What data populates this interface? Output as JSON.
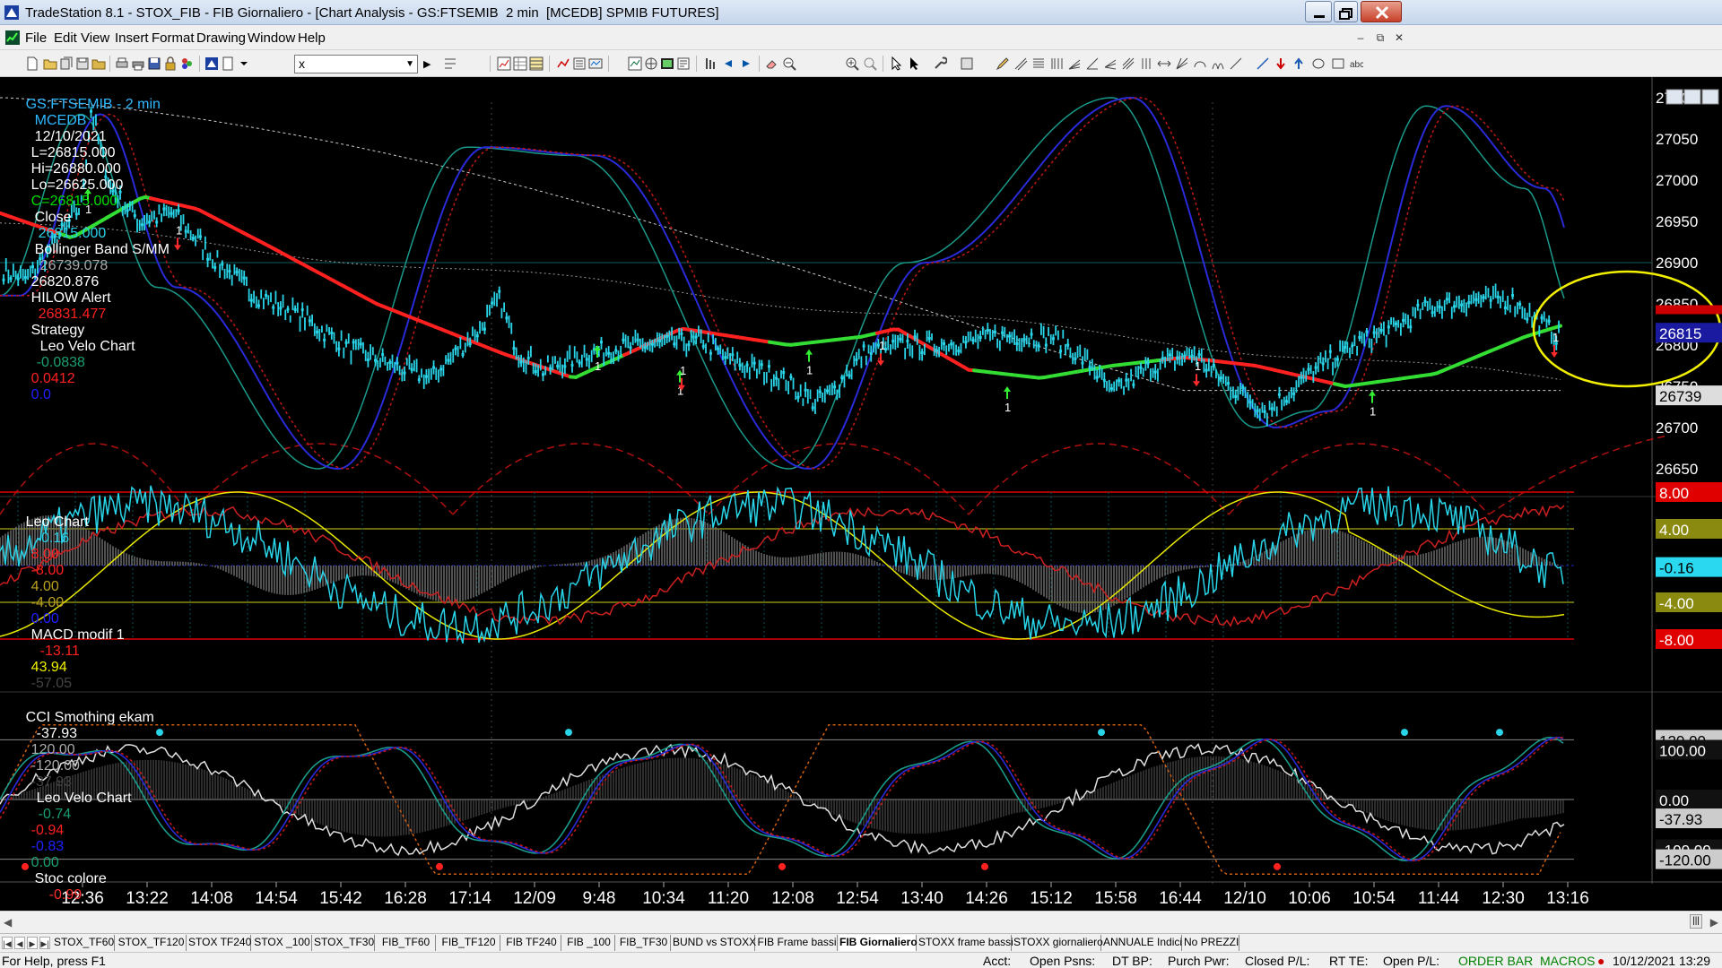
{
  "window": {
    "title": "TradeStation 8.1 - STOX_FIB - FIB Giornaliero - [Chart Analysis - GS:FTSEMIB  2 min  [MCEDB] SPMIB FUTURES]"
  },
  "menu": [
    "File",
    "Edit",
    "View",
    "Insert",
    "Format",
    "Drawing",
    "Window",
    "Help"
  ],
  "toolbar": {
    "symbol_value": "x"
  },
  "header": {
    "symbol": "GS:FTSEMIB - 2 min",
    "exchange": "MCEDB",
    "date": "12/10/2021",
    "last": "L=26815.000",
    "high": "Hi=26880.000",
    "low": "Lo=26625.000",
    "close_c": "C=26815.000",
    "close_label": "Close",
    "close_val": "26815.000",
    "bb_label": "Bollinger Band S/MM",
    "bb_v1": "26739.078",
    "bb_v2": "26820.876",
    "hilow_label": "HILOW Alert",
    "hilow_val": "26831.477",
    "strategy_label": "Strategy",
    "leo_label": "Leo Velo Chart",
    "leo_v1": "-0.0838",
    "leo_v2": "0.0412",
    "leo_v3": "0.0"
  },
  "price_axis": {
    "labels": [
      "27100",
      "27050",
      "27000",
      "26950",
      "26900",
      "26850",
      "26800",
      "26750",
      "26700",
      "26650"
    ],
    "last_price_tag": "26815",
    "bb_tag": "26739",
    "hidden_tag": "26831"
  },
  "panel2": {
    "name": "Leo Chart",
    "v1": "-0.16",
    "v2": "8.00",
    "v3": "-8.00",
    "v4": "4.00",
    "v5": "-4.00",
    "v6": "0.00",
    "macd_label": "MACD modif 1",
    "macd_v1": "-13.11",
    "macd_v2": "43.94",
    "macd_v3": "-57.05",
    "axis_tags": [
      "8.00",
      "4.00",
      "-0.16",
      "-4.00",
      "-8.00"
    ]
  },
  "panel3": {
    "name": "CCI Smothing ekam",
    "v1": "-37.93",
    "v2": "120.00",
    "v3": "-120.00",
    "v4": "-37.93",
    "leo_label": "Leo Velo Chart",
    "leo_v1": "-0.74",
    "leo_v2": "-0.94",
    "leo_v3": "-0.83",
    "leo_v4": "0.00",
    "stoc_label": "Stoc colore",
    "stoc_v": "-0.99",
    "axis_tags": [
      "120.00",
      "100.00",
      "0.00",
      "-37.93",
      "-100.00",
      "-120.00"
    ]
  },
  "time_axis": [
    "12:36",
    "13:22",
    "14:08",
    "14:54",
    "15:42",
    "16:28",
    "17:14",
    "12/09",
    "9:48",
    "10:34",
    "11:20",
    "12:08",
    "12:54",
    "13:40",
    "14:26",
    "15:12",
    "15:58",
    "16:44",
    "12/10",
    "10:06",
    "10:54",
    "11:44",
    "12:30",
    "13:16"
  ],
  "tabs": [
    "STOX_TF60",
    "STOX_TF120",
    "STOX TF240",
    "STOX _100",
    "STOX_TF30",
    "FIB_TF60",
    "FIB_TF120",
    "FIB TF240",
    "FIB _100",
    "FIB_TF30",
    "BUND vs STOXX",
    "FIB Frame bassi",
    "FIB Giornaliero",
    "STOXX frame bassi",
    "STOXX giornaliero",
    "ANNUALE Indici",
    "No PREZZI"
  ],
  "active_tab": "FIB Giornaliero",
  "status": {
    "help": "For Help, press F1",
    "acct": "Acct:",
    "open_psns": "Open Psns:",
    "dt_bp": "DT BP:",
    "purch_pwr": "Purch Pwr:",
    "closed_pl": "Closed P/L:",
    "rt_te": "RT TE:",
    "open_pl": "Open P/L:",
    "order_bar": "ORDER BAR",
    "macros": "MACROS",
    "datetime": "10/12/2021 13:29"
  },
  "colors": {
    "background": "#000000",
    "price_bars": "#29d4e8",
    "hilow_red": "#ff2020",
    "hilow_green": "#33dd33",
    "bollinger_blue": "#2a2ad8",
    "bollinger_teal": "#1a9a8a",
    "highlight_circle": "#f2f000"
  },
  "chart_data": {
    "type": "line",
    "title": "GS:FTSEMIB - 2 min",
    "x": [
      "12:36",
      "13:22",
      "14:08",
      "14:54",
      "15:42",
      "16:28",
      "17:14",
      "12/09",
      "9:48",
      "10:34",
      "11:20",
      "12:08",
      "12:54",
      "13:40",
      "14:26",
      "15:12",
      "15:58",
      "16:44",
      "12/10",
      "10:06",
      "10:54",
      "11:44",
      "12:30",
      "13:16"
    ],
    "ylim": [
      26625,
      27125
    ],
    "series": [
      {
        "name": "Close",
        "values": [
          26880,
          26975,
          26960,
          26880,
          26850,
          26790,
          26770,
          26760,
          26760,
          26850,
          26790,
          26800,
          26790,
          26810,
          26730,
          26760,
          26790,
          26790,
          26775,
          26750,
          26720,
          26790,
          26850,
          26815
        ]
      },
      {
        "name": "HILOW Alert",
        "values": [
          26960,
          26940,
          26960,
          26930,
          26880,
          26840,
          26790,
          26780,
          26760,
          26780,
          26800,
          26810,
          26800,
          26810,
          26790,
          26760,
          26770,
          26780,
          26790,
          26770,
          26740,
          26760,
          26790,
          26831
        ]
      }
    ],
    "grid": false
  }
}
